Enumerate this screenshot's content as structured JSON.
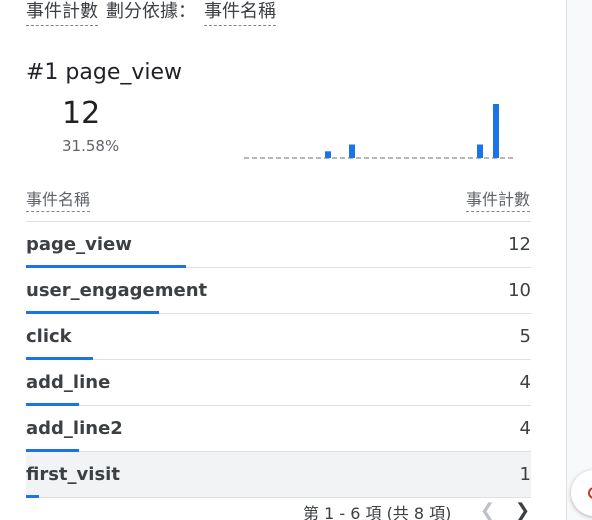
{
  "header": {
    "metric": "事件計數",
    "split_label": "劃分依據：",
    "dimension": "事件名稱"
  },
  "top_item": {
    "title": "#1 page_view",
    "value": "12",
    "percent": "31.58%"
  },
  "table": {
    "col_name": "事件名稱",
    "col_count": "事件計數",
    "rows": [
      {
        "name": "page_view",
        "count": "12",
        "share": 1.0
      },
      {
        "name": "user_engagement",
        "count": "10",
        "share": 0.833
      },
      {
        "name": "click",
        "count": "5",
        "share": 0.417
      },
      {
        "name": "add_line",
        "count": "4",
        "share": 0.333
      },
      {
        "name": "add_line2",
        "count": "4",
        "share": 0.333
      },
      {
        "name": "first_visit",
        "count": "1",
        "share": 0.083
      }
    ]
  },
  "pagination": {
    "label": "第 1 - 6 項 (共 8 項)"
  },
  "chart_data": {
    "type": "bar",
    "series": [
      {
        "values": [
          0,
          0,
          0,
          0,
          0,
          0,
          0,
          0,
          0,
          0,
          1,
          0,
          0,
          2,
          0,
          0,
          0,
          0,
          0,
          0,
          0,
          0,
          0,
          0,
          0,
          0,
          0,
          0,
          0,
          2,
          0,
          8,
          0,
          0
        ]
      }
    ],
    "grid": false
  },
  "colors": {
    "accent": "#1a73e8",
    "highlight_row": "#f1f3f4"
  },
  "icons": {
    "prev": "chevron-left-icon",
    "next": "chevron-right-icon"
  }
}
